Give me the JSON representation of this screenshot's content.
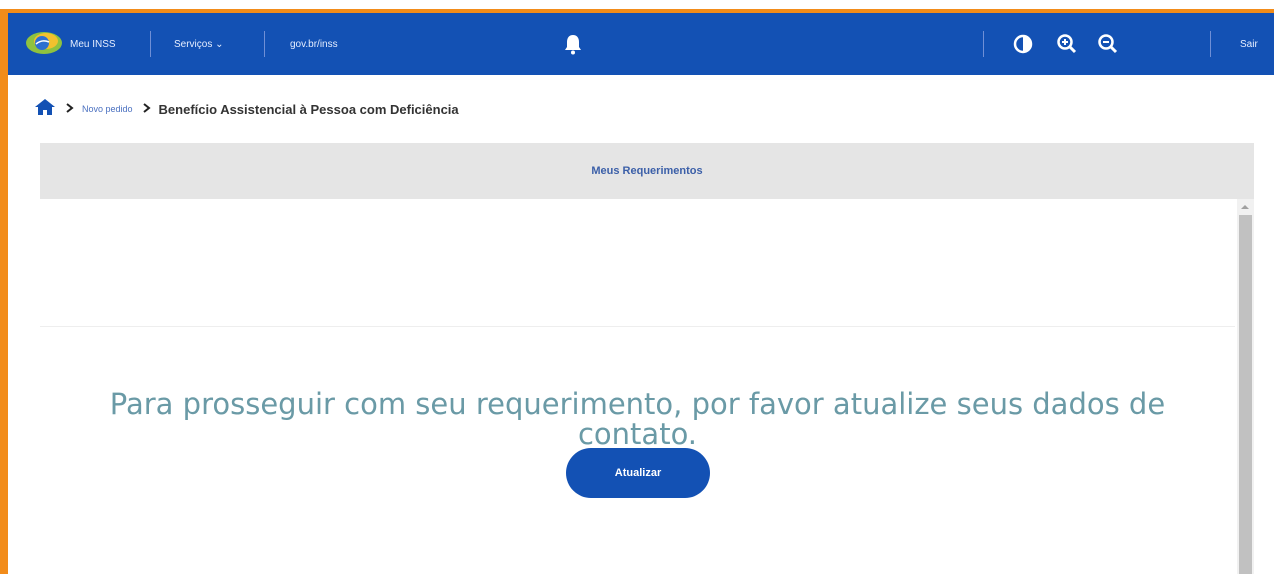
{
  "header": {
    "app_name": "Meu INSS",
    "services_label": "Serviços ⌄",
    "govbr_label": "gov.br/inss",
    "logout_label": "Sair"
  },
  "breadcrumb": {
    "step_label": "Novo pedido",
    "current_label": "Benefício Assistencial à Pessoa com Deficiência"
  },
  "panel": {
    "title": "Meus Requerimentos",
    "message": "Para prosseguir com seu requerimento, por favor atualize seus dados de contato.",
    "button_label": "Atualizar"
  },
  "colors": {
    "header_blue": "#1351b4",
    "frame_orange": "#f28c1a",
    "message_teal": "#6a9aa6"
  }
}
